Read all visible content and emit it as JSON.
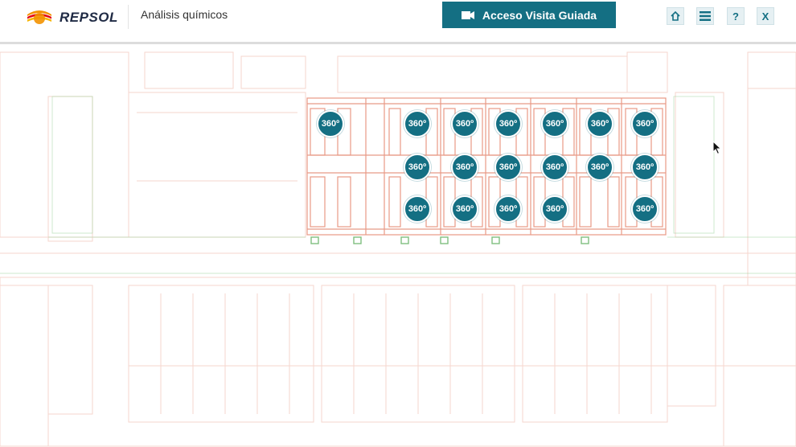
{
  "header": {
    "brand": "REPSOL",
    "title": "Análisis químicos",
    "guided_visit_label": "Acceso Visita Guiada",
    "actions": [
      {
        "name": "home-button",
        "glyph": "⌂"
      },
      {
        "name": "menu-button",
        "glyph": "≡"
      },
      {
        "name": "help-button",
        "glyph": "?"
      },
      {
        "name": "close-button",
        "glyph": "X"
      }
    ]
  },
  "hotspots": {
    "label": "360º"
  },
  "colors": {
    "accent": "#146f83",
    "plan_lines": "#e89a86",
    "plan_faded": "#f3c9bd",
    "plan_green": "#7fbf7f"
  }
}
